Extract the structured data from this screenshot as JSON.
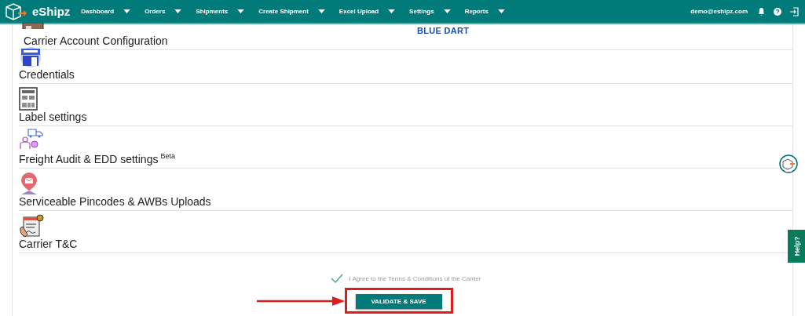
{
  "navbar": {
    "logo": "eShipz",
    "menu": [
      {
        "label": "Dashboard"
      },
      {
        "label": "Orders"
      },
      {
        "label": "Shipments"
      },
      {
        "label": "Create Shipment"
      },
      {
        "label": "Excel Upload"
      },
      {
        "label": "Settings"
      },
      {
        "label": "Reports"
      }
    ],
    "user": "demo@eshipz.com"
  },
  "carrier_logo": "BLUE DART",
  "sections": [
    {
      "label": "Carrier Account Configuration"
    },
    {
      "label": "Credentials"
    },
    {
      "label": "Label settings"
    },
    {
      "label": "Freight Audit & EDD settings",
      "badge": "Beta"
    },
    {
      "label": "Serviceable Pincodes & AWBs Uploads"
    },
    {
      "label": "Carrier T&C"
    }
  ],
  "agreement": {
    "text": "I Agree to the Terms & Conditions of the Carrier",
    "checked": true
  },
  "save_button": "VALIDATE & SAVE",
  "help_tab": "Help?"
}
